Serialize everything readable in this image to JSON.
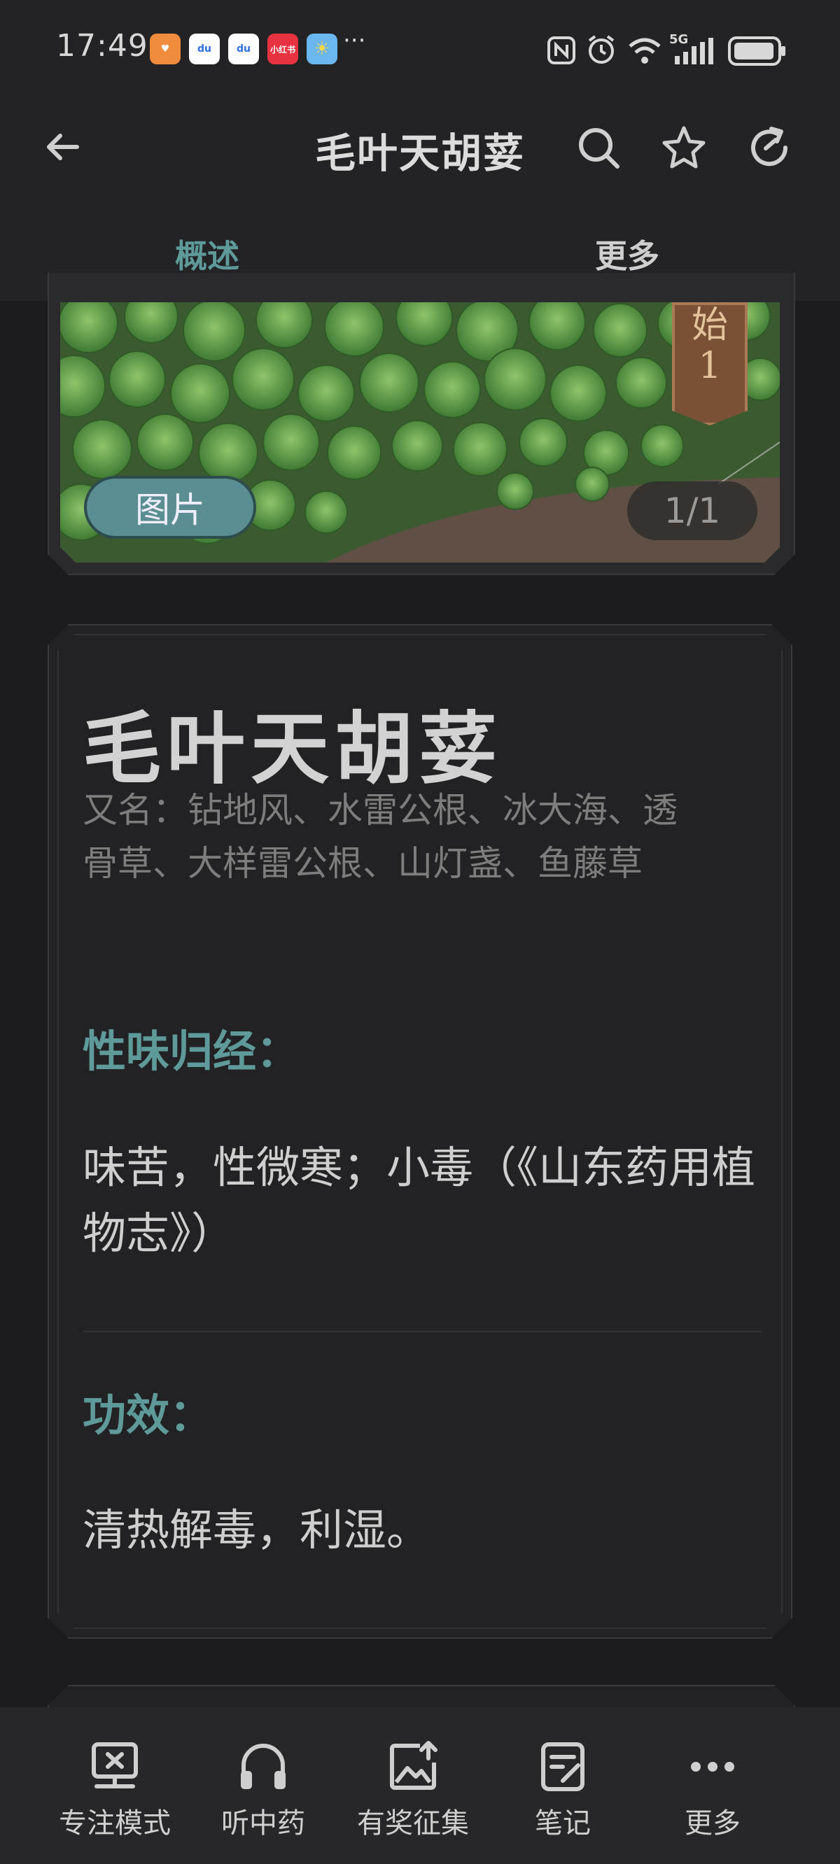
{
  "status_bar": {
    "time": "17:49",
    "apps": [
      {
        "name": "heart-app-icon",
        "color": "#f08c3c",
        "text": "♥"
      },
      {
        "name": "baidu-app-icon",
        "color": "#ffffff",
        "text": "du"
      },
      {
        "name": "baidu-app-icon-2",
        "color": "#ffffff",
        "text": "du"
      },
      {
        "name": "xiaohongshu-app-icon",
        "color": "#e6333f",
        "text": "小红书"
      },
      {
        "name": "weather-app-icon",
        "color": "#6ab7f0",
        "text": "☀"
      }
    ],
    "more": "···",
    "network": "5G"
  },
  "header": {
    "title": "毛叶天胡荽",
    "tabs": [
      "概述",
      "更多"
    ]
  },
  "image_card": {
    "label": "图片",
    "counter": "1/1",
    "ribbon": "始1"
  },
  "info": {
    "name": "毛叶天胡荽",
    "aliases": "又名：钻地风、水雷公根、冰大海、透骨草、大样雷公根、山灯盏、鱼藤草",
    "sections": [
      {
        "title": "性味归经：",
        "body": "味苦，性微寒；小毒（《山东药用植物志》）"
      },
      {
        "title": "功效：",
        "body": "清热解毒，利湿。"
      }
    ]
  },
  "bottom_nav": [
    {
      "label": "专注模式",
      "icon": "focus-mode-icon"
    },
    {
      "label": "听中药",
      "icon": "headphones-icon"
    },
    {
      "label": "有奖征集",
      "icon": "image-upload-icon"
    },
    {
      "label": "笔记",
      "icon": "note-icon"
    },
    {
      "label": "更多",
      "icon": "more-dots-icon"
    }
  ],
  "colors": {
    "accent": "#5e9a9a",
    "background": "#1b1b1d",
    "card": "#222224",
    "ribbon": "#7a5036"
  }
}
